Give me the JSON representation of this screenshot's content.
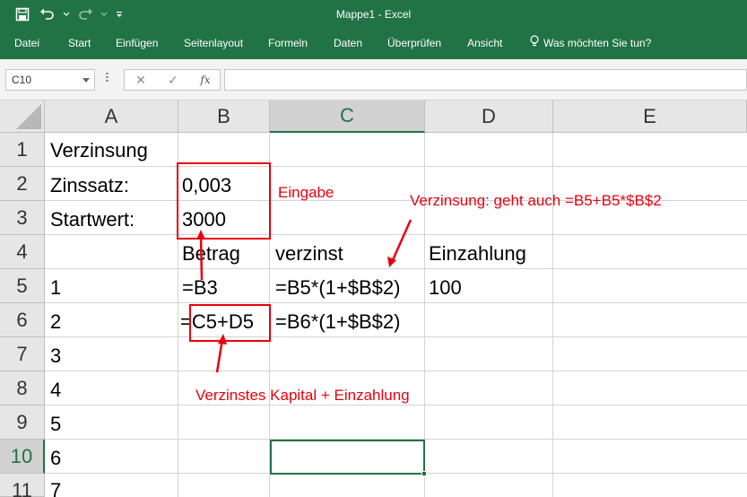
{
  "app": {
    "title": "Mappe1 - Excel",
    "accent": "#217346"
  },
  "quick_access": {
    "icons": [
      "save-icon",
      "undo-icon",
      "undo-dropdown-icon",
      "redo-icon",
      "redo-dropdown-icon",
      "customize-icon"
    ]
  },
  "ribbon": {
    "tabs": [
      "Datei",
      "Start",
      "Einfügen",
      "Seitenlayout",
      "Formeln",
      "Daten",
      "Überprüfen",
      "Ansicht"
    ],
    "tell_me": "Was möchten Sie tun?"
  },
  "formula_bar": {
    "name_box": "C10",
    "cancel_symbol": "✕",
    "enter_symbol": "✓",
    "fx_symbol": "fx",
    "formula": ""
  },
  "sheet": {
    "columns": [
      "A",
      "B",
      "C",
      "D",
      "E"
    ],
    "selected_column": "C",
    "rows": [
      "1",
      "2",
      "3",
      "4",
      "5",
      "6",
      "7",
      "8",
      "9",
      "10",
      "11"
    ],
    "selected_row": "10",
    "cells": {
      "A1": "Verzinsung",
      "A2": "Zinssatz:",
      "B2": "0,003",
      "A3": "Startwert:",
      "B3": "3000",
      "B4": "Betrag",
      "C4": "verzinst",
      "D4": "Einzahlung",
      "A5": "1",
      "B5": "=B3",
      "C5": "=B5*(1+$B$2)",
      "D5": "100",
      "A6": "2",
      "B6": "=C5+D5",
      "C6": "=B6*(1+$B$2)",
      "A7": "3",
      "A8": "4",
      "A9": "5",
      "A10": "6",
      "A11": "7"
    },
    "active_cell": "C10"
  },
  "annotations": {
    "color": "#e8000f",
    "eingabe": "Eingabe",
    "verzinsung": "Verzinsung: geht auch =B5+B5*$B$2",
    "kapital": "Verzinstes Kapital + Einzahlung"
  }
}
